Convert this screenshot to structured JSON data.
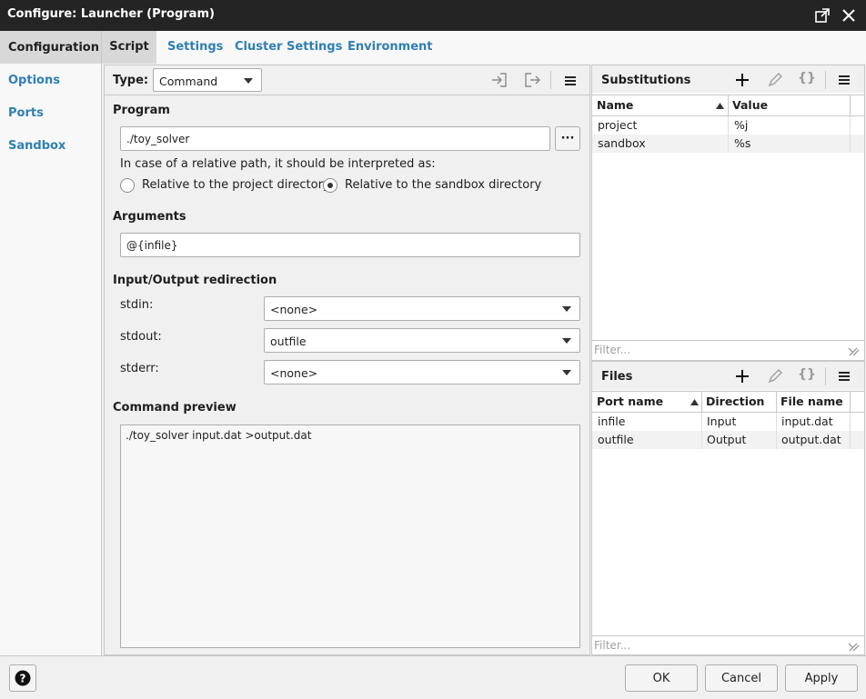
{
  "window": {
    "title": "Configure: Launcher (Program)"
  },
  "left_nav": {
    "items": [
      {
        "label": "Configuration"
      },
      {
        "label": "Options"
      },
      {
        "label": "Ports"
      },
      {
        "label": "Sandbox"
      }
    ]
  },
  "tabs": [
    {
      "label": "Script"
    },
    {
      "label": "Settings"
    },
    {
      "label": "Cluster Settings"
    },
    {
      "label": "Environment"
    }
  ],
  "script": {
    "type_label": "Type:",
    "type_value": "Command",
    "program_heading": "Program",
    "program_value": "./toy_solver",
    "browse_label": "···",
    "relative_hint": "In case of a relative path, it should be interpreted as:",
    "radio_project": "Relative to the project directory",
    "radio_sandbox": "Relative to the sandbox directory",
    "arguments_heading": "Arguments",
    "arguments_value": "@{infile}",
    "redirect_heading": "Input/Output redirection",
    "stdin_label": "stdin:",
    "stdin_value": "<none>",
    "stdout_label": "stdout:",
    "stdout_value": "outfile",
    "stderr_label": "stderr:",
    "stderr_value": "<none>",
    "preview_heading": "Command preview",
    "preview_text": "./toy_solver input.dat >output.dat"
  },
  "substitutions": {
    "title": "Substitutions",
    "columns": [
      "Name",
      "Value"
    ],
    "rows": [
      {
        "name": "project",
        "value": "%j"
      },
      {
        "name": "sandbox",
        "value": "%s"
      }
    ],
    "filter_placeholder": "Filter..."
  },
  "files": {
    "title": "Files",
    "columns": [
      "Port name",
      "Direction",
      "File name"
    ],
    "rows": [
      {
        "port": "infile",
        "direction": "Input",
        "file": "input.dat"
      },
      {
        "port": "outfile",
        "direction": "Output",
        "file": "output.dat"
      }
    ],
    "filter_placeholder": "Filter..."
  },
  "footer": {
    "help_label": "?",
    "ok_label": "OK",
    "cancel_label": "Cancel",
    "apply_label": "Apply"
  }
}
